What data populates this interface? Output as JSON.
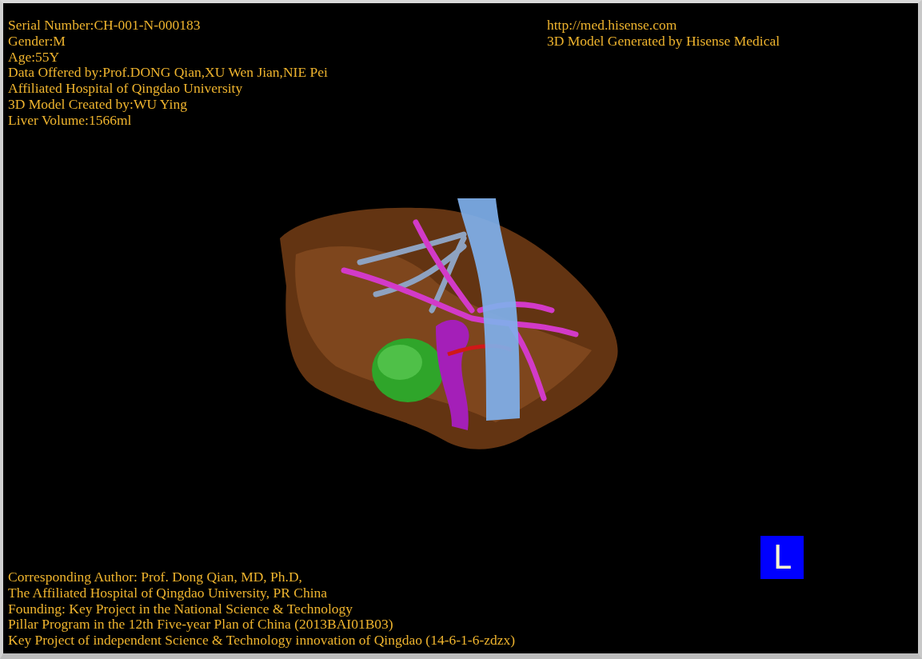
{
  "info_left": [
    "Serial Number:CH-001-N-000183",
    "Gender:M",
    "Age:55Y",
    "Data Offered by:Prof.DONG Qian,XU Wen Jian,NIE Pei",
    "Affiliated Hospital of Qingdao University",
    "3D Model Created by:WU Ying",
    "Liver Volume:1566ml"
  ],
  "info_right": [
    "http://med.hisense.com",
    "3D Model Generated by Hisense Medical"
  ],
  "credits": [
    "Corresponding Author: Prof. Dong Qian, MD, Ph.D,",
    "The Affiliated Hospital of Qingdao University, PR China",
    "Founding: Key Project in the National Science & Technology",
    "Pillar Program in the 12th Five-year Plan of China (2013BAI01B03)",
    "Key Project of independent Science & Technology innovation of Qingdao (14-6-1-6-zdzx)"
  ],
  "orientation_marker": "L"
}
